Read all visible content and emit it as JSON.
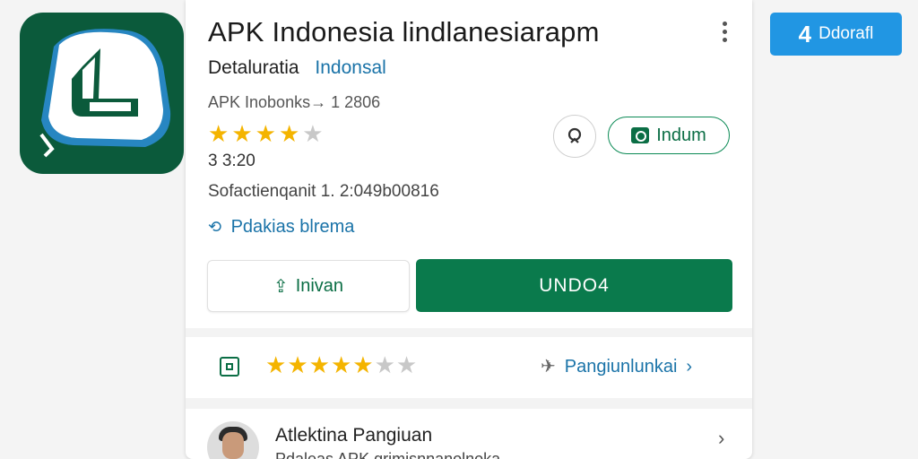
{
  "app": {
    "title": "APK Indonesia lindlanesiarapm",
    "developer": "Detaluratia",
    "developer_link": "Indonsal",
    "meta_line": "APK Inobonks→  1 2806",
    "rating_value": "3 3:20",
    "rating_stars": {
      "filled": 4,
      "total": 5
    },
    "info_line": "Sofactienqanit  1.  2:049b00816",
    "pdakias_label": "Pdakias blrema"
  },
  "actions": {
    "secondary_label": "Indum",
    "outline_label": "Inivan",
    "primary_label": "UNDO4"
  },
  "rating_row": {
    "stars": {
      "filled": 5,
      "total": 7
    },
    "link_label": "Pangiunlunkai"
  },
  "review": {
    "name": "Atlektina Pangiuan",
    "subtitle": "Pdaleas APK grimisnnanolnoka"
  },
  "badge": {
    "number": "4",
    "label": "Ddorafl"
  },
  "colors": {
    "brand_green": "#0a7a4c",
    "accent_blue": "#1a73a8",
    "badge_blue": "#2196e3",
    "star": "#f4b400"
  }
}
